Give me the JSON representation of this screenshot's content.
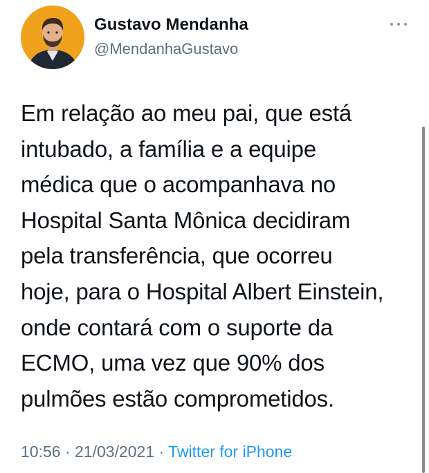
{
  "author": {
    "name": "Gustavo Mendanha",
    "handle": "@MendanhaGustavo"
  },
  "tweet": {
    "text": "Em relação ao meu pai, que está\nintubado, a família e a equipe\nmédica que o acompanhava no\nHospital Santa Mônica decidiram\npela transferência, que ocorreu\nhoje, para o Hospital Albert Einstein,\nonde contará com o suporte da\nECMO, uma vez que 90% dos\npulmões estão comprometidos.",
    "time": "10:56",
    "separator": " · ",
    "date": "21/03/2021",
    "source": "Twitter for iPhone"
  },
  "icons": {
    "more": "more-horizontal-icon"
  },
  "colors": {
    "text": "#0f1419",
    "secondary": "#5b7083",
    "link": "#1d9bf0",
    "avatar_bg": "#f0a21c"
  }
}
